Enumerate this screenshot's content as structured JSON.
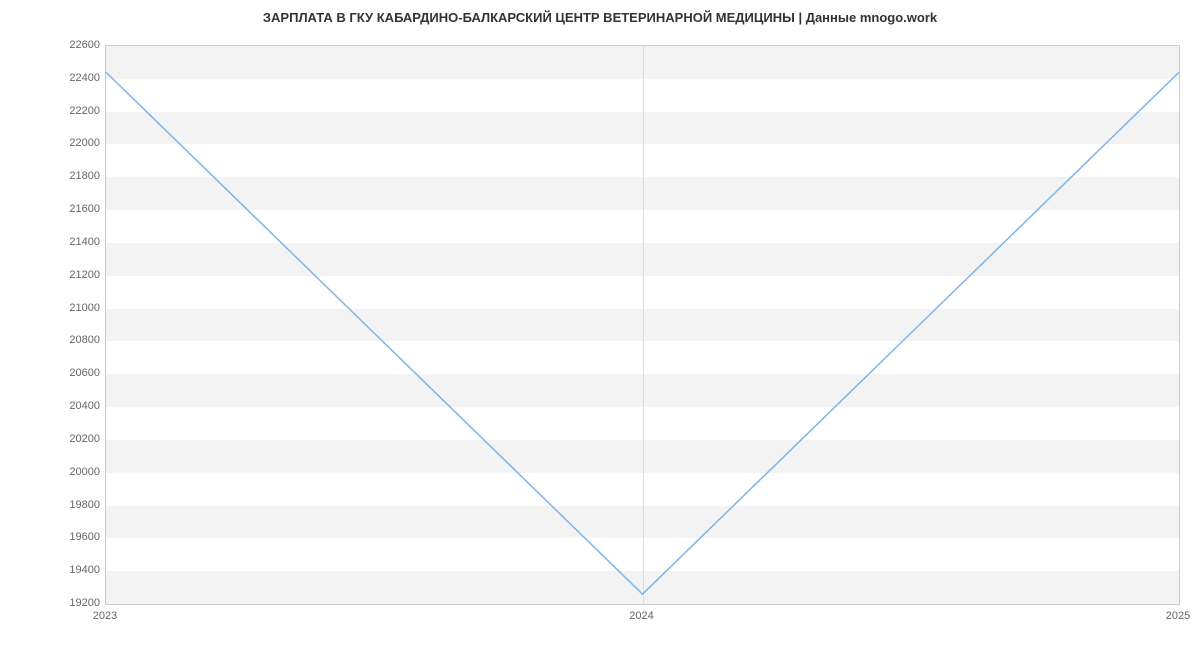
{
  "chart_data": {
    "type": "line",
    "title": "ЗАРПЛАТА В ГКУ КАБАРДИНО-БАЛКАРСКИЙ ЦЕНТР ВЕТЕРИНАРНОЙ МЕДИЦИНЫ | Данные mnogo.work",
    "xlabel": "",
    "ylabel": "",
    "x": [
      2023,
      2024,
      2025
    ],
    "values": [
      22440,
      19260,
      22440
    ],
    "ylim": [
      19200,
      22600
    ],
    "y_ticks": [
      19200,
      19400,
      19600,
      19800,
      20000,
      20200,
      20400,
      20600,
      20800,
      21000,
      21200,
      21400,
      21600,
      21800,
      22000,
      22200,
      22400,
      22600
    ],
    "x_ticks": [
      2023,
      2024,
      2025
    ],
    "line_color": "#7cb5ec"
  }
}
